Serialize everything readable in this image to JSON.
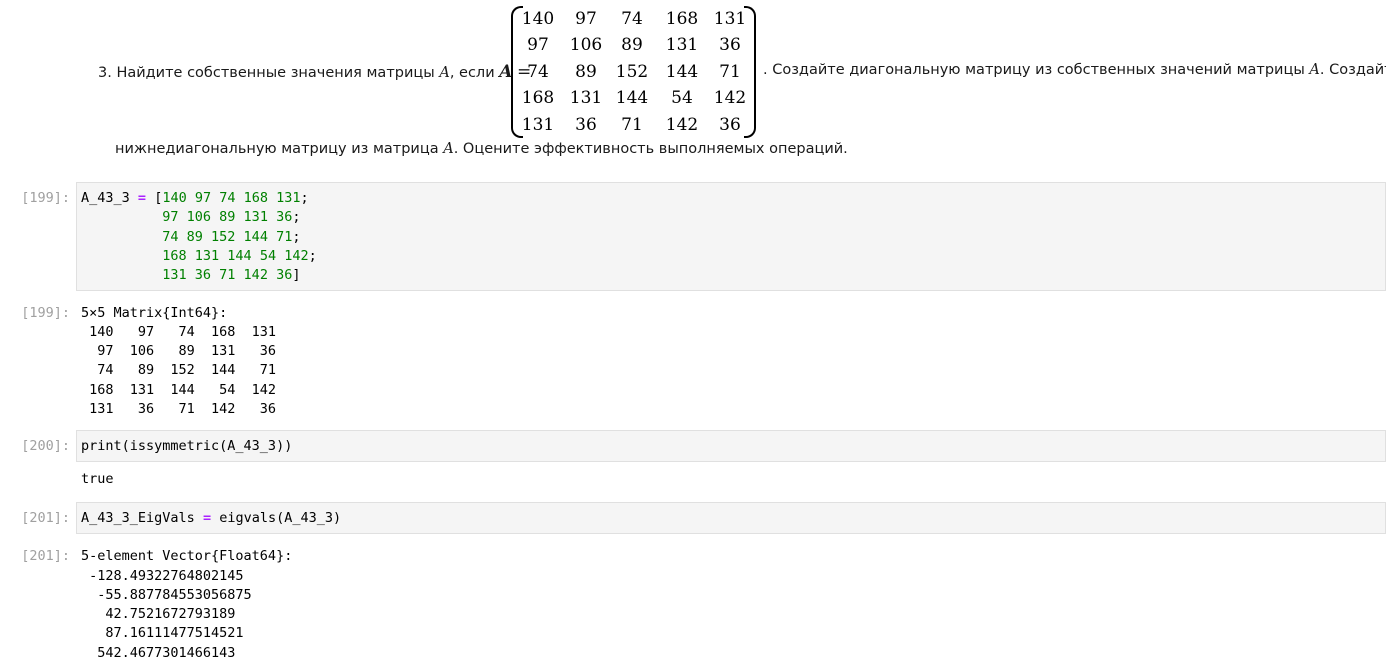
{
  "task": {
    "line1_prefix": "3. Найдите собственные значения матрицы ",
    "var_a": "A",
    "line1_mid": ", если ",
    "bold_a": "A",
    "equals": "=",
    "line1_after": ". Создайте диагональную матрицу из собственных значений матрицы ",
    "var_a2": "A",
    "line1_end": ". Создайте",
    "line2_prefix": "нижнедиагональную матрицу из матрица ",
    "var_a3": "A",
    "line2_end": ". Оцените эффективность выполняемых операций.",
    "matrix": [
      [
        "140",
        "97",
        "74",
        "168",
        "131"
      ],
      [
        "97",
        "106",
        "89",
        "131",
        "36"
      ],
      [
        "74",
        "89",
        "152",
        "144",
        "71"
      ],
      [
        "168",
        "131",
        "144",
        "54",
        "142"
      ],
      [
        "131",
        "36",
        "71",
        "142",
        "36"
      ]
    ]
  },
  "cell_199": {
    "prompt_in": "[199]:",
    "code": {
      "var": "A_43_3",
      "assign": "=",
      "open": "[",
      "row1": "140 97 74 168 131",
      "sep1": ";",
      "row2": "97 106 89 131 36",
      "sep2": ";",
      "row3": "74 89 152 144 71",
      "sep3": ";",
      "row4": "168 131 144 54 142",
      "sep4": ";",
      "row5": "131 36 71 142 36",
      "close": "]"
    },
    "prompt_out": "[199]:",
    "output": [
      "5×5 Matrix{Int64}:",
      " 140   97   74  168  131",
      "  97  106   89  131   36",
      "  74   89  152  144   71",
      " 168  131  144   54  142",
      " 131   36   71  142   36"
    ]
  },
  "cell_200": {
    "prompt_in": "[200]:",
    "code": "print(issymmetric(A_43_3))",
    "output": "true"
  },
  "cell_201": {
    "prompt_in": "[201]:",
    "code": {
      "var": "A_43_3_EigVals",
      "assign": "=",
      "call": "eigvals(A_43_3)"
    },
    "prompt_out": "[201]:",
    "output": [
      "5-element Vector{Float64}:",
      " -128.49322764802145",
      "  -55.887784553056875",
      "   42.7521672793189",
      "   87.16111477514521",
      "  542.4677301466143"
    ]
  },
  "colors": {
    "number": "#008000",
    "operator": "#aa22ff",
    "prompt": "#a0a0a0",
    "code_bg": "#f5f5f5"
  }
}
